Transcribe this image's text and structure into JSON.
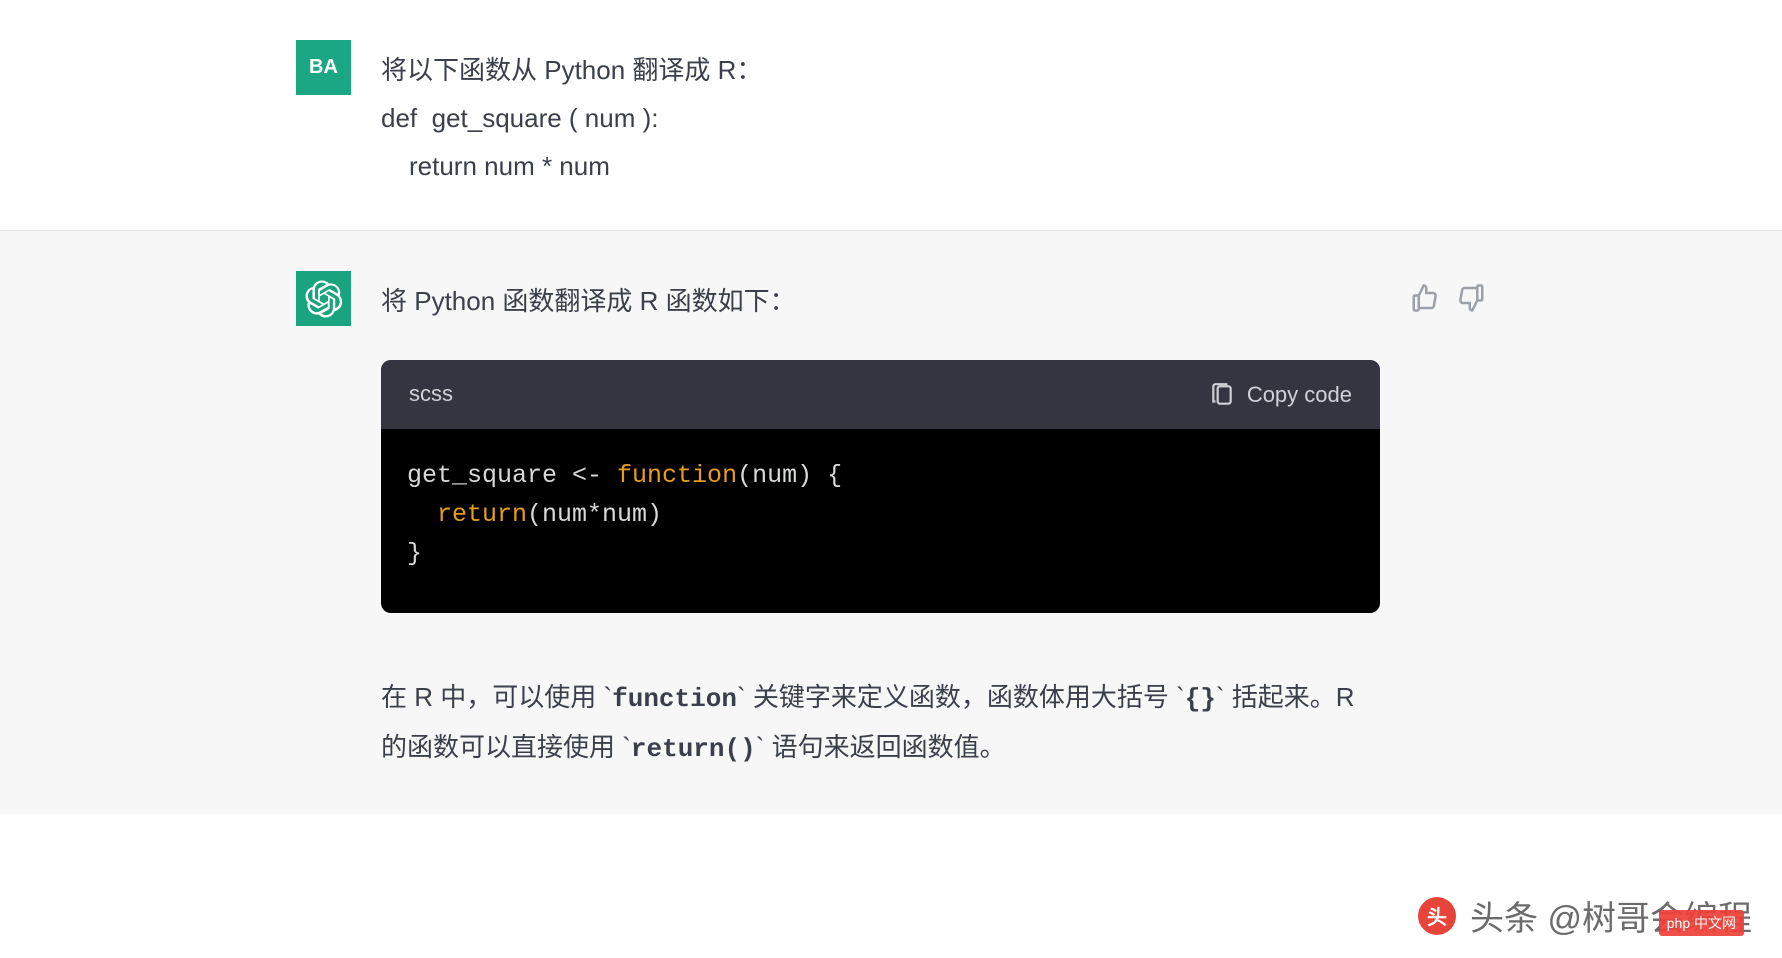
{
  "user": {
    "avatar_label": "BA",
    "line1": "将以下函数从 Python 翻译成 R：",
    "line2": "def  get_square ( num ):",
    "line3": "return num * num"
  },
  "assistant": {
    "intro": "将 Python 函数翻译成 R 函数如下：",
    "code": {
      "language": "scss",
      "copy_label": "Copy code",
      "line1_a": "get_square <- ",
      "line1_b": "function",
      "line1_c": "(num) {",
      "line2_indent": "  ",
      "line2_a": "return",
      "line2_b": "(num*num)",
      "line3": "}"
    },
    "explanation": {
      "part1": "在 R 中，可以使用 `",
      "code1": "function",
      "part2": "` 关键字来定义函数，函数体用大括号 `",
      "code2": "{}",
      "part3": "` 括起来。R 的函数可以直接使用 `",
      "code3": "return()",
      "part4": "` 语句来返回函数值。"
    }
  },
  "watermark": {
    "text": "头条 @树哥会编程",
    "badge": "php 中文网"
  }
}
